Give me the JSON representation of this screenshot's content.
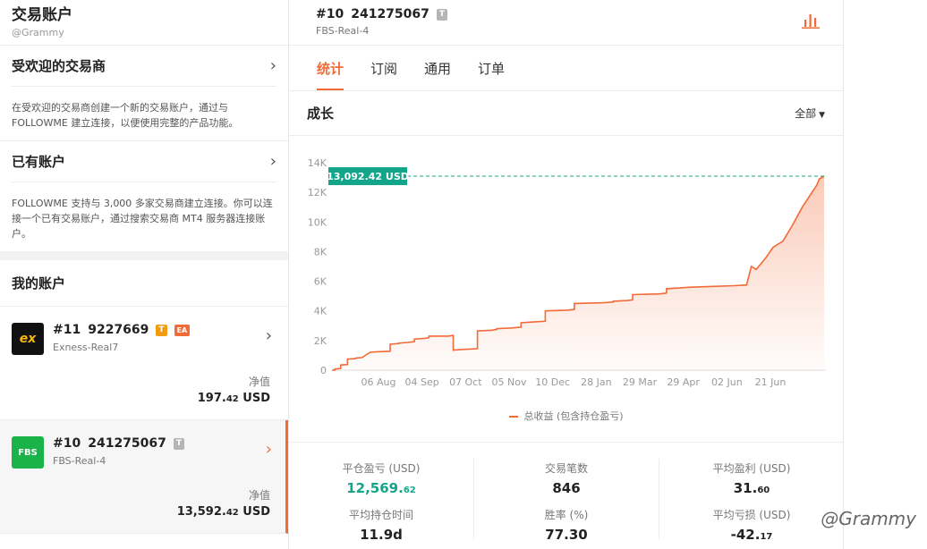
{
  "sidebar": {
    "title": "交易账户",
    "handle": "@Grammy",
    "popular": {
      "title": "受欢迎的交易商",
      "desc": "在受欢迎的交易商创建一个新的交易账户，通过与 FOLLOWME 建立连接，以便使用完整的产品功能。"
    },
    "existing": {
      "title": "已有账户",
      "desc": "FOLLOWME 支持与 3,000 多家交易商建立连接。你可以连接一个已有交易账户，通过搜索交易商 MT4 服务器连接账户。"
    },
    "my_accounts_title": "我的账户",
    "accounts": [
      {
        "index": "#11",
        "number": "9227669",
        "badge": "T",
        "badge2": "EA",
        "server": "Exness-Real7",
        "net_label": "净值",
        "net_int": "197.",
        "net_dec": "42",
        "currency": "USD",
        "logo_text": "ex"
      },
      {
        "index": "#10",
        "number": "241275067",
        "badge": "T",
        "server": "FBS-Real-4",
        "net_label": "净值",
        "net_int": "13,592.",
        "net_dec": "42",
        "currency": "USD",
        "logo_text": "FBS"
      }
    ]
  },
  "main": {
    "account_index": "#10",
    "account_number": "241275067",
    "account_badge": "T",
    "server": "FBS-Real-4",
    "tabs": [
      "统计",
      "订阅",
      "通用",
      "订单"
    ],
    "active_tab": 0,
    "section_title": "成长",
    "filter_label": "全部",
    "legend": "总收益 (包含持仓盈亏)",
    "metrics": [
      {
        "label": "平仓盈亏 (USD)",
        "int": "12,569.",
        "dec": "62",
        "green": true
      },
      {
        "label": "交易笔数",
        "int": "846",
        "dec": ""
      },
      {
        "label": "平均盈利 (USD)",
        "int": "31.",
        "dec": "60"
      },
      {
        "label": "平均持仓时间",
        "int": "11.9d",
        "dec": ""
      },
      {
        "label": "胜率 (%)",
        "int": "77.30",
        "dec": ""
      },
      {
        "label": "平均亏损 (USD)",
        "int": "-42.",
        "dec": "17"
      }
    ]
  },
  "watermark": "@Grammy",
  "chart_data": {
    "type": "area",
    "title": "成长",
    "series_name": "总收益 (包含持仓盈亏)",
    "current_value_label": "13,092.42 USD",
    "current_value": 13092.42,
    "ylim": [
      0,
      14000
    ],
    "yticks": [
      0,
      2000,
      4000,
      6000,
      8000,
      10000,
      12000,
      14000
    ],
    "ytick_labels": [
      "0",
      "2K",
      "4K",
      "6K",
      "8K",
      "10K",
      "12K",
      "14K"
    ],
    "xtick_labels": [
      "06 Aug",
      "04 Sep",
      "07 Oct",
      "05 Nov",
      "10 Dec",
      "28 Jan",
      "29 Mar",
      "29 Apr",
      "02 Jun",
      "21 Jun"
    ],
    "x": [
      0,
      0.06,
      0.06,
      0.18,
      0.18,
      0.32,
      0.32,
      0.48,
      0.5,
      0.5,
      0.62,
      0.62,
      0.78,
      0.78,
      0.88,
      1.2,
      1.2,
      1.38,
      1.38,
      1.55,
      1.7,
      1.7,
      1.92,
      2.0,
      2.0,
      2.4,
      2.5,
      2.5,
      2.7,
      3.0,
      3.0,
      3.3,
      3.4,
      3.4,
      3.7,
      3.9,
      3.9,
      4.15,
      4.4,
      4.4,
      4.85,
      5.0,
      5.0,
      5.6,
      5.8,
      5.8,
      6.1,
      6.2,
      6.2,
      6.75,
      6.9,
      6.9,
      7.4,
      7.8,
      8.3,
      8.55,
      8.65,
      8.75,
      8.85,
      8.95,
      9.1,
      9.3,
      9.5,
      9.7,
      9.9,
      10.0,
      10.05,
      10.15
    ],
    "values": [
      0,
      0,
      80,
      120,
      350,
      380,
      750,
      780,
      800,
      820,
      850,
      850,
      1200,
      1200,
      1230,
      1280,
      1750,
      1800,
      1830,
      1870,
      1920,
      2100,
      2150,
      2200,
      2300,
      2300,
      2350,
      1350,
      1400,
      1450,
      2650,
      2700,
      2750,
      2800,
      2850,
      2900,
      3200,
      3250,
      3300,
      4000,
      4050,
      4100,
      4500,
      4550,
      4600,
      4650,
      4700,
      4750,
      5100,
      5150,
      5200,
      5500,
      5600,
      5650,
      5700,
      5750,
      7000,
      6800,
      7200,
      7600,
      8300,
      8700,
      9800,
      11000,
      12000,
      12500,
      12900,
      13092
    ]
  }
}
